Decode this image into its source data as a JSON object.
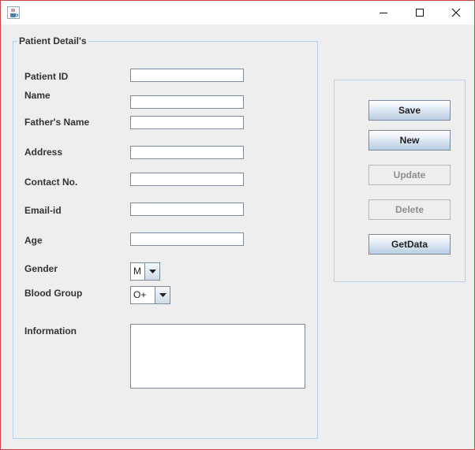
{
  "window": {
    "icon": "java-cup-icon",
    "controls": [
      "minimize-icon",
      "maximize-icon",
      "close-icon"
    ]
  },
  "patient_panel": {
    "title": "Patient Detail's",
    "fields": {
      "patient_id": {
        "label": "Patient ID",
        "value": ""
      },
      "name": {
        "label": "Name",
        "value": ""
      },
      "fathers_name": {
        "label": "Father's Name",
        "value": ""
      },
      "address": {
        "label": "Address",
        "value": ""
      },
      "contact_no": {
        "label": "Contact No.",
        "value": ""
      },
      "email_id": {
        "label": "Email-id",
        "value": ""
      },
      "age": {
        "label": "Age",
        "value": ""
      }
    },
    "gender": {
      "label": "Gender",
      "selected": "M"
    },
    "blood_group": {
      "label": "Blood Group",
      "selected": "O+"
    },
    "information": {
      "label": "Information",
      "value": ""
    }
  },
  "actions": {
    "save": {
      "label": "Save",
      "enabled": true
    },
    "new": {
      "label": "New",
      "enabled": true
    },
    "update": {
      "label": "Update",
      "enabled": false
    },
    "delete": {
      "label": "Delete",
      "enabled": false
    },
    "getdata": {
      "label": "GetData",
      "enabled": true
    }
  }
}
